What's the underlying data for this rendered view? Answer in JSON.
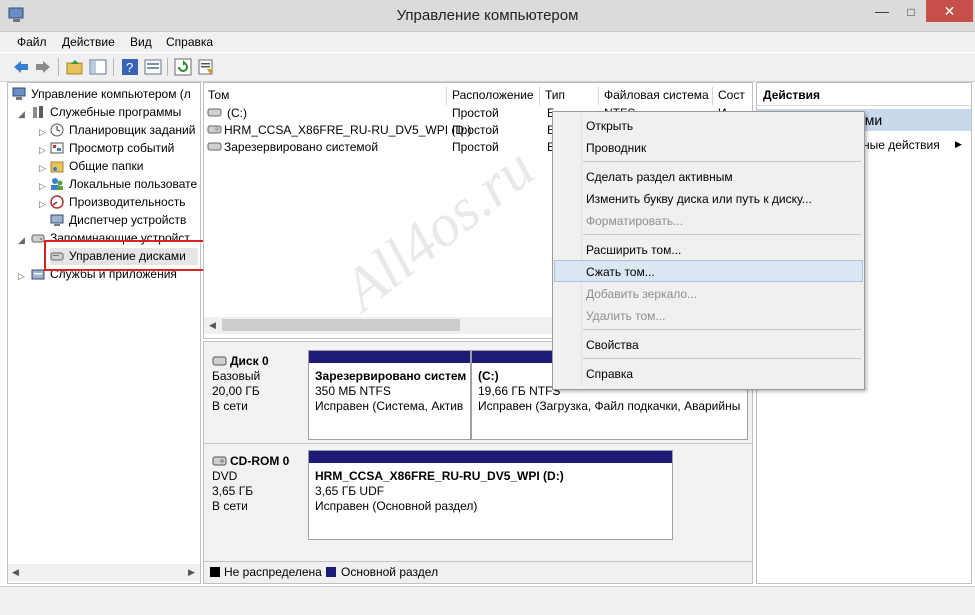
{
  "window": {
    "title": "Управление компьютером"
  },
  "menu": [
    "Файл",
    "Действие",
    "Вид",
    "Справка"
  ],
  "toolbar_icons": [
    "back-arrow-icon",
    "forward-arrow-icon",
    "up-folder-icon",
    "show-hide-tree-icon",
    "help-icon",
    "properties-icon",
    "refresh-icon",
    "export-icon"
  ],
  "tree": {
    "root": "Управление компьютером (л",
    "services": "Служебные программы",
    "scheduler": "Планировщик заданий",
    "events": "Просмотр событий",
    "folders": "Общие папки",
    "users": "Локальные пользовате",
    "performance": "Производительность",
    "devices": "Диспетчер устройств",
    "storage": "Запоминающие устройст",
    "disk_mgmt": "Управление дисками",
    "services_apps": "Службы и приложения"
  },
  "volumes": {
    "columns": [
      "Том",
      "Расположение",
      "Тип",
      "Файловая система",
      "Сост"
    ],
    "rows": [
      {
        "name": "(C:)",
        "layout": "Простой",
        "type": "Б",
        "fs": "NTFS",
        "status": "И"
      },
      {
        "name": "HRM_CCSA_X86FRE_RU-RU_DV5_WPI (D:)",
        "layout": "Простой",
        "type": "Б",
        "fs": "",
        "status": ""
      },
      {
        "name": "Зарезервировано системой",
        "layout": "Простой",
        "type": "Б",
        "fs": "",
        "status": ""
      }
    ]
  },
  "disks": {
    "disk0": {
      "name": "Диск 0",
      "kind": "Базовый",
      "size": "20,00 ГБ",
      "state": "В сети"
    },
    "disk0_p1": {
      "title": "Зарезервировано систем",
      "size": "350 МБ NTFS",
      "status": "Исправен (Система, Актив"
    },
    "disk0_p2": {
      "title": "(C:)",
      "size": "19,66 ГБ NTFS",
      "status": "Исправен (Загрузка, Файл подкачки, Аварийны"
    },
    "cd0": {
      "name": "CD-ROM 0",
      "kind": "DVD",
      "size": "3,65 ГБ",
      "state": "В сети"
    },
    "cd0_p1": {
      "title": "HRM_CCSA_X86FRE_RU-RU_DV5_WPI  (D:)",
      "size": "3,65 ГБ UDF",
      "status": "Исправен (Основной раздел)"
    }
  },
  "legend": {
    "unallocated": "Не распределена",
    "primary": "Основной раздел",
    "unallocated_color": "#000000",
    "primary_color": "#1d1b76"
  },
  "actions": {
    "header": "Действия",
    "section": "ами",
    "more": "ные действия"
  },
  "context_menu": {
    "open": "Открыть",
    "explorer": "Проводник",
    "mark_active": "Сделать раздел активным",
    "change_letter": "Изменить букву диска или путь к диску...",
    "format": "Форматировать...",
    "extend": "Расширить том...",
    "shrink": "Сжать том...",
    "add_mirror": "Добавить зеркало...",
    "delete": "Удалить том...",
    "properties": "Свойства",
    "help": "Справка"
  },
  "watermark": "All4os.ru",
  "colors": {
    "primary_partition": "#1d1b76",
    "close_button": "#c7504a",
    "highlight_box": "#d8231f",
    "menu_highlight": "#dbe6f3"
  }
}
